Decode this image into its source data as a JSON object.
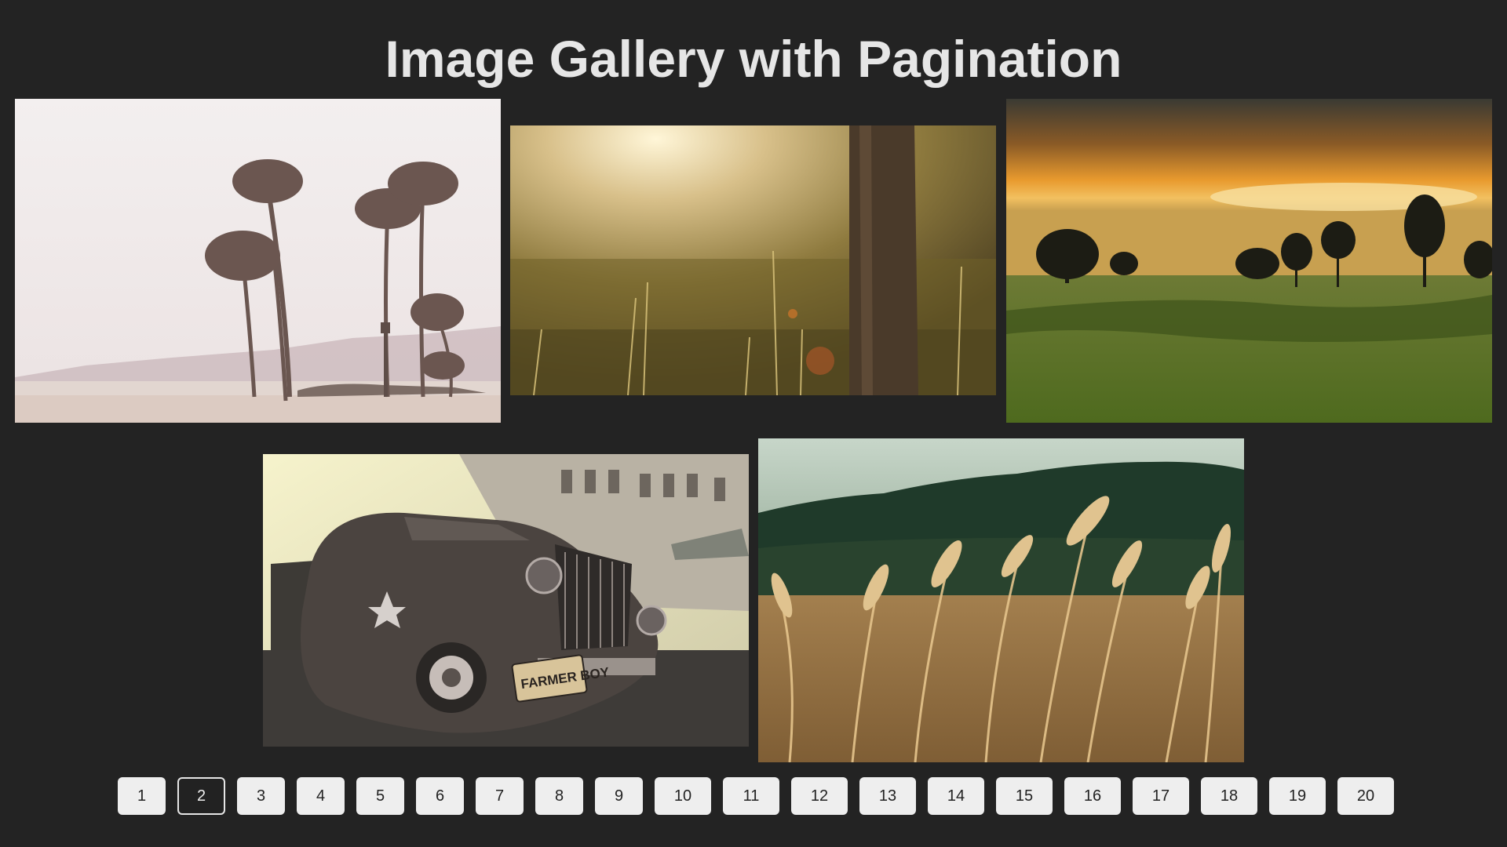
{
  "page": {
    "title": "Image Gallery with Pagination"
  },
  "gallery": {
    "images": [
      {
        "subject": "palm trees on a hazy beach"
      },
      {
        "subject": "sunlit grass beside a tree trunk"
      },
      {
        "subject": "sunset over a green meadow with trees"
      },
      {
        "subject": "vintage car with \"FARMER BOY\" plate in front of a building"
      },
      {
        "subject": "golden wheat field with dark trees"
      }
    ],
    "plate_text": "FARMER BOY"
  },
  "pagination": {
    "current": 2,
    "pages": [
      "1",
      "2",
      "3",
      "4",
      "5",
      "6",
      "7",
      "8",
      "9",
      "10",
      "11",
      "12",
      "13",
      "14",
      "15",
      "16",
      "17",
      "18",
      "19",
      "20"
    ]
  },
  "colors": {
    "background": "#232323",
    "title": "#e6e6e6",
    "button": "#eeeeee",
    "active_button": "#222222"
  }
}
